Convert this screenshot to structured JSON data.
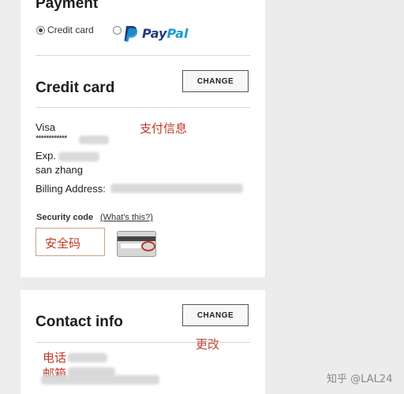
{
  "payment": {
    "title": "Payment",
    "credit_card_option": "Credit card",
    "paypal_text": "PayPal"
  },
  "credit_card": {
    "title": "Credit card",
    "change_label": "CHANGE",
    "brand": "Visa",
    "masked_number": "************",
    "exp_label": "Exp.",
    "name": "san zhang",
    "billing_label": "Billing Address:",
    "annotation": "支付信息",
    "security_label": "Security code",
    "whats_this": "(What's this?)",
    "security_placeholder": "安全码"
  },
  "contact": {
    "title": "Contact info",
    "change_label": "CHANGE",
    "annotation_change": "更改",
    "phone_note": "电话",
    "email_note": "邮箱"
  },
  "watermark": "知乎 @LAL24"
}
